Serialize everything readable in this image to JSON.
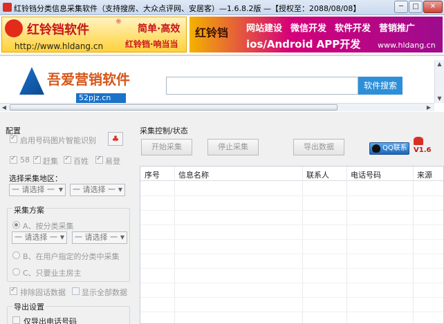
{
  "window": {
    "title": "红铃铛分类信息采集软件（支持搜房、大众点评网、安居客）—1.6.8.2版 —【授权至：2088/08/08】",
    "min_label": "─",
    "max_label": "□",
    "close_label": "✕"
  },
  "banner": {
    "brand": "红铃铛软件",
    "reg": "®",
    "url": "http://www.hldang.cn",
    "slogan1": "简单·高效",
    "slogan2": "红铃铛·响当当",
    "right_brand": "红铃铛",
    "services": [
      "网站建设",
      "微信开发",
      "软件开发",
      "营销推广"
    ],
    "app_line": "ios/Android APP开发",
    "right_url": "www.hldang.cn"
  },
  "web": {
    "brand": "吾爱营销软件",
    "domain": "52pjz.cn",
    "search_placeholder": "",
    "search_button": "软件搜索"
  },
  "config": {
    "title": "配置",
    "smart_ocr": "启用号码图片智能识别",
    "sources": [
      "58",
      "赶集",
      "百姓",
      "易登"
    ],
    "region_label": "选择采集地区：",
    "select_placeholder": "一 请选择 一",
    "plan_title": "采集方案",
    "plan_a": "A、按分类采集",
    "plan_b": "B、在用户指定的分类中采集",
    "plan_c": "C、只要业主房主",
    "exclude_landline": "排除固话数据",
    "show_all": "显示全部数据",
    "export_title": "导出设置",
    "export_phone_only": "仅导出电话号码"
  },
  "control": {
    "title": "采集控制/状态",
    "start": "开始采集",
    "stop": "停止采集",
    "export": "导出数据",
    "qq": "QQ联系",
    "version": "V1.6"
  },
  "table": {
    "columns": [
      "序号",
      "信息名称",
      "联系人",
      "电话号码",
      "来源"
    ]
  }
}
